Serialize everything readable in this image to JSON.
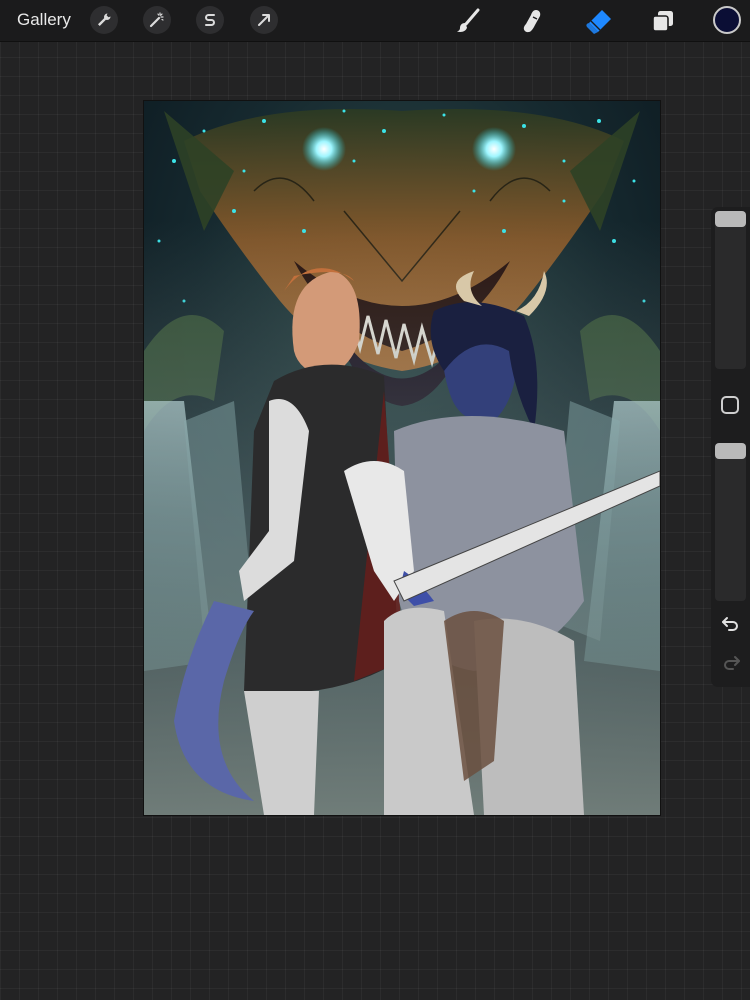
{
  "toolbar": {
    "gallery_label": "Gallery",
    "left_tools": [
      {
        "name": "actions",
        "icon": "wrench-icon"
      },
      {
        "name": "adjustments",
        "icon": "magic-wand-icon"
      },
      {
        "name": "selection",
        "icon": "selection-s-icon"
      },
      {
        "name": "transform",
        "icon": "arrow-cursor-icon"
      }
    ],
    "right_tools": [
      {
        "name": "brush",
        "icon": "brush-icon",
        "active": false
      },
      {
        "name": "smudge",
        "icon": "smudge-finger-icon",
        "active": false
      },
      {
        "name": "eraser",
        "icon": "eraser-icon",
        "active": true
      },
      {
        "name": "layers",
        "icon": "layers-icon",
        "active": false
      }
    ],
    "current_color": "#0b0e35",
    "active_tool_color": "#1e88ff"
  },
  "sidebar": {
    "brush_size_level": 0.0,
    "opacity_level": 0.0,
    "modify_button_icon": "square-modify-icon",
    "undo_icon": "undo-arrow-icon",
    "redo_icon": "redo-arrow-icon",
    "redo_enabled": false
  },
  "canvas": {
    "artwork": "digital-painting"
  }
}
